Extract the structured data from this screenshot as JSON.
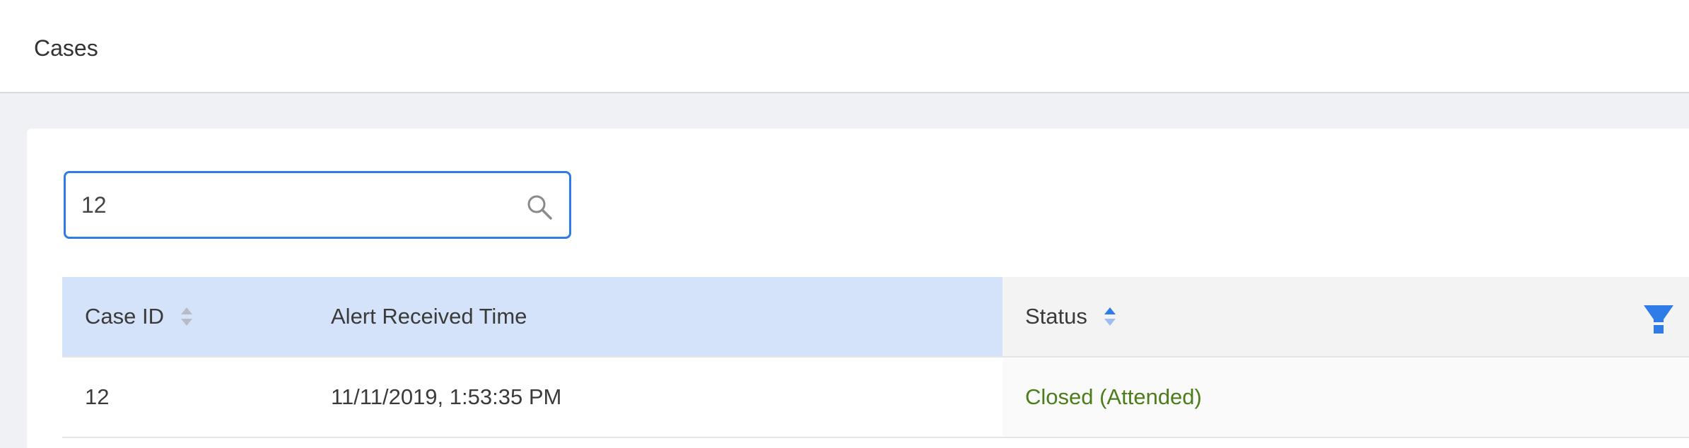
{
  "header": {
    "title": "Cases"
  },
  "search": {
    "value": "12",
    "placeholder": ""
  },
  "table": {
    "columns": [
      {
        "label": "Case ID",
        "sortable": true
      },
      {
        "label": "Alert Received Time",
        "sortable": false
      },
      {
        "label": "Status",
        "sortable": true,
        "filterable": true
      }
    ],
    "rows": [
      {
        "case_id": "12",
        "alert_time": "11/11/2019, 1:53:35 PM",
        "status": "Closed (Attended)"
      }
    ]
  },
  "colors": {
    "accent": "#2f7be8",
    "header_highlight": "#d5e3fa",
    "status_closed": "#4b7d1a"
  },
  "icons": {
    "search": "search-icon",
    "sort": "sort-icon",
    "filter": "filter-icon"
  }
}
